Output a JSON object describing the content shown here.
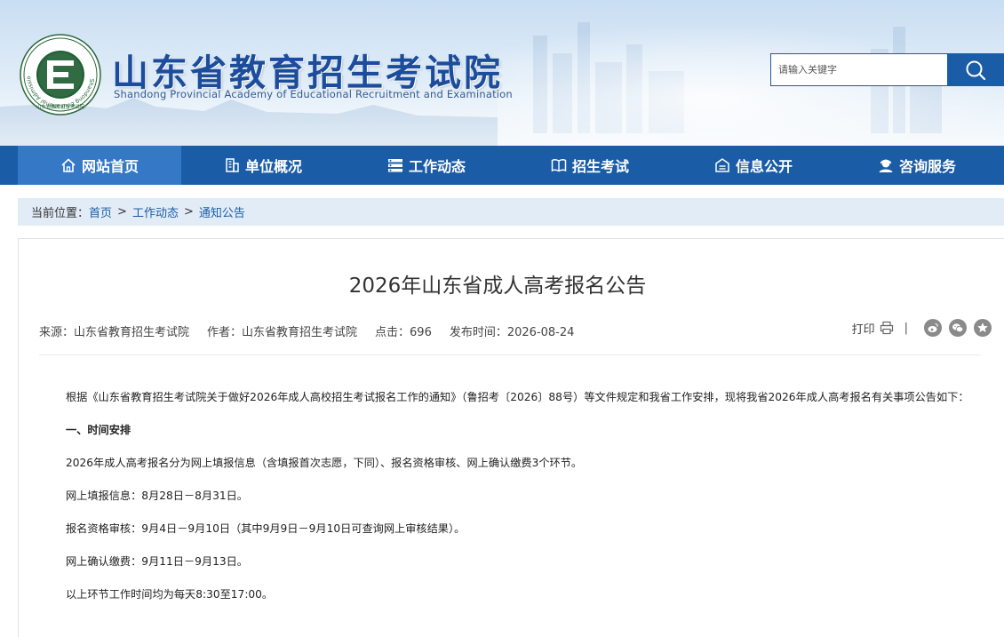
{
  "header": {
    "title": "山东省教育招生考试院",
    "subtitle": "Shandong Provincial Academy of Educational Recruitment and Examination",
    "logo_ring_text": "Shandong Educational Admission & Examination",
    "logo_bottom_text": "山东省教育招生考试院"
  },
  "search": {
    "placeholder": "请输入关键字",
    "value": ""
  },
  "nav": {
    "items": [
      {
        "label": "网站首页",
        "icon": "home-icon"
      },
      {
        "label": "单位概况",
        "icon": "building-icon"
      },
      {
        "label": "工作动态",
        "icon": "list-icon"
      },
      {
        "label": "招生考试",
        "icon": "book-icon"
      },
      {
        "label": "信息公开",
        "icon": "info-icon"
      },
      {
        "label": "咨询服务",
        "icon": "support-icon"
      }
    ]
  },
  "breadcrumb": {
    "prefix": "当前位置：",
    "items": [
      "首页",
      "工作动态",
      "通知公告"
    ],
    "separator": ">"
  },
  "article": {
    "title": "2026年山东省成人高考报名公告",
    "meta": {
      "source": "来源：山东省教育招生考试院",
      "author": "作者：山东省教育招生考试院",
      "views": "点击：696",
      "date": "发布时间：2026-08-24"
    },
    "tools": {
      "print": "打印",
      "separator": "|"
    },
    "paragraphs": [
      "根据《山东省教育招生考试院关于做好2026年成人高校招生考试报名工作的通知》（鲁招考〔2026〕88号）等文件规定和我省工作安排，现将我省2026年成人高考报名有关事项公告如下：",
      "一、时间安排",
      "2026年成人高考报名分为网上填报信息（含填报首次志愿，下同）、报名资格审核、网上确认缴费3个环节。",
      "网上填报信息：8月28日－8月31日。",
      "报名资格审核：9月4日－9月10日（其中9月9日－9月10日可查询网上审核结果）。",
      "网上确认缴费：9月11日－9月13日。",
      "以上环节工作时间均为每天8:30至17:00。"
    ]
  },
  "colors": {
    "brand_blue": "#1b5ca6",
    "nav_active": "#3478c6",
    "breadcrumb_bg": "#e1ecf7",
    "title_blue": "#1c4d9c"
  }
}
